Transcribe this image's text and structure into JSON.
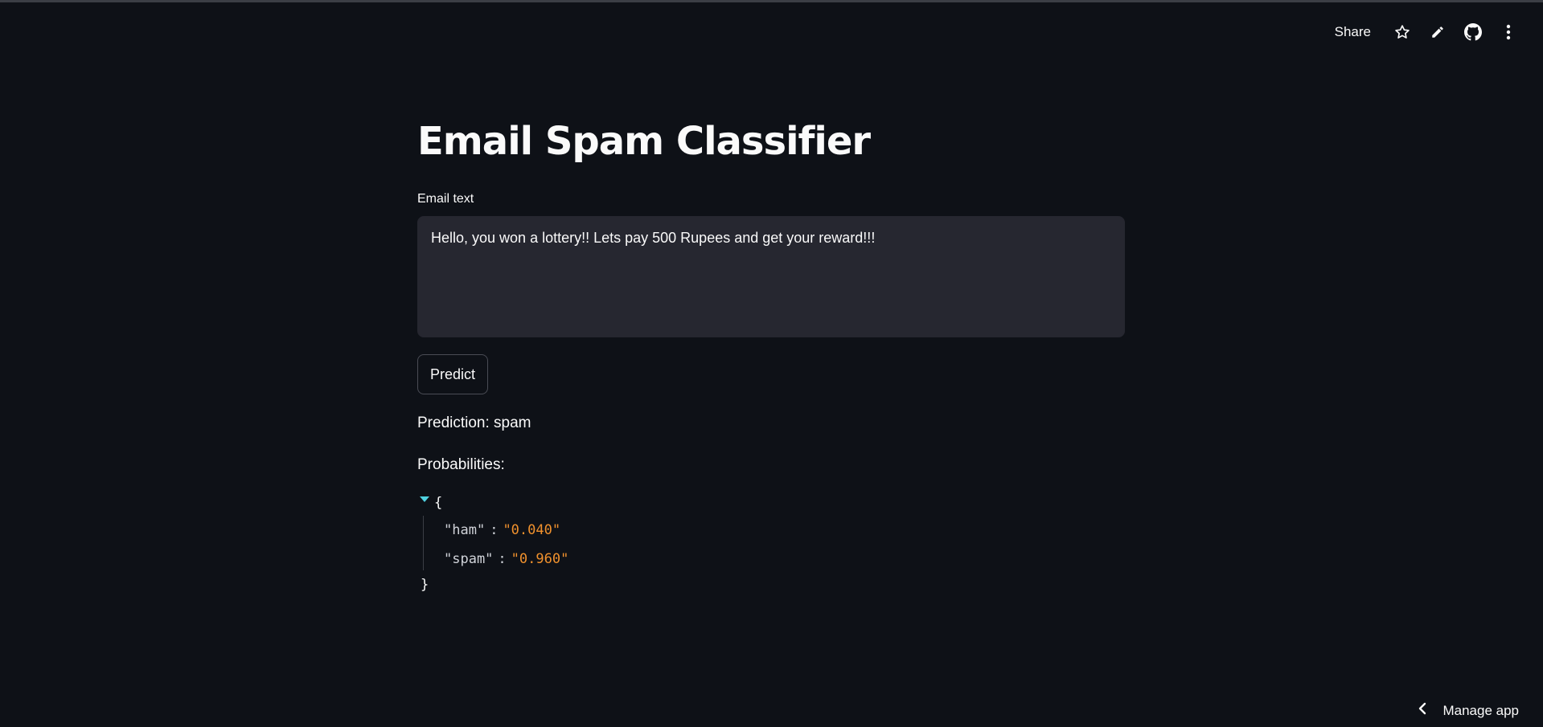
{
  "toolbar": {
    "share_label": "Share",
    "icons": [
      "star-icon",
      "pencil-icon",
      "github-icon",
      "more-vertical-icon"
    ]
  },
  "main": {
    "title": "Email Spam Classifier",
    "email_field": {
      "label": "Email text",
      "value": "Hello, you won a lottery!! Lets pay 500 Rupees and get your reward!!!"
    },
    "predict_button_label": "Predict",
    "prediction_text": "Prediction: spam",
    "probabilities_label": "Probabilities:",
    "probabilities_json": {
      "open_brace": "{",
      "close_brace": "}",
      "colon": ":",
      "rows": [
        {
          "key": "\"ham\"",
          "value": "\"0.040\""
        },
        {
          "key": "\"spam\"",
          "value": "\"0.960\""
        }
      ]
    }
  },
  "footer": {
    "manage_app_label": "Manage app"
  },
  "colors": {
    "background": "#0e1117",
    "textarea_background": "#262730",
    "json_value": "#f0912d",
    "json_toggle": "#4fd1e0"
  }
}
